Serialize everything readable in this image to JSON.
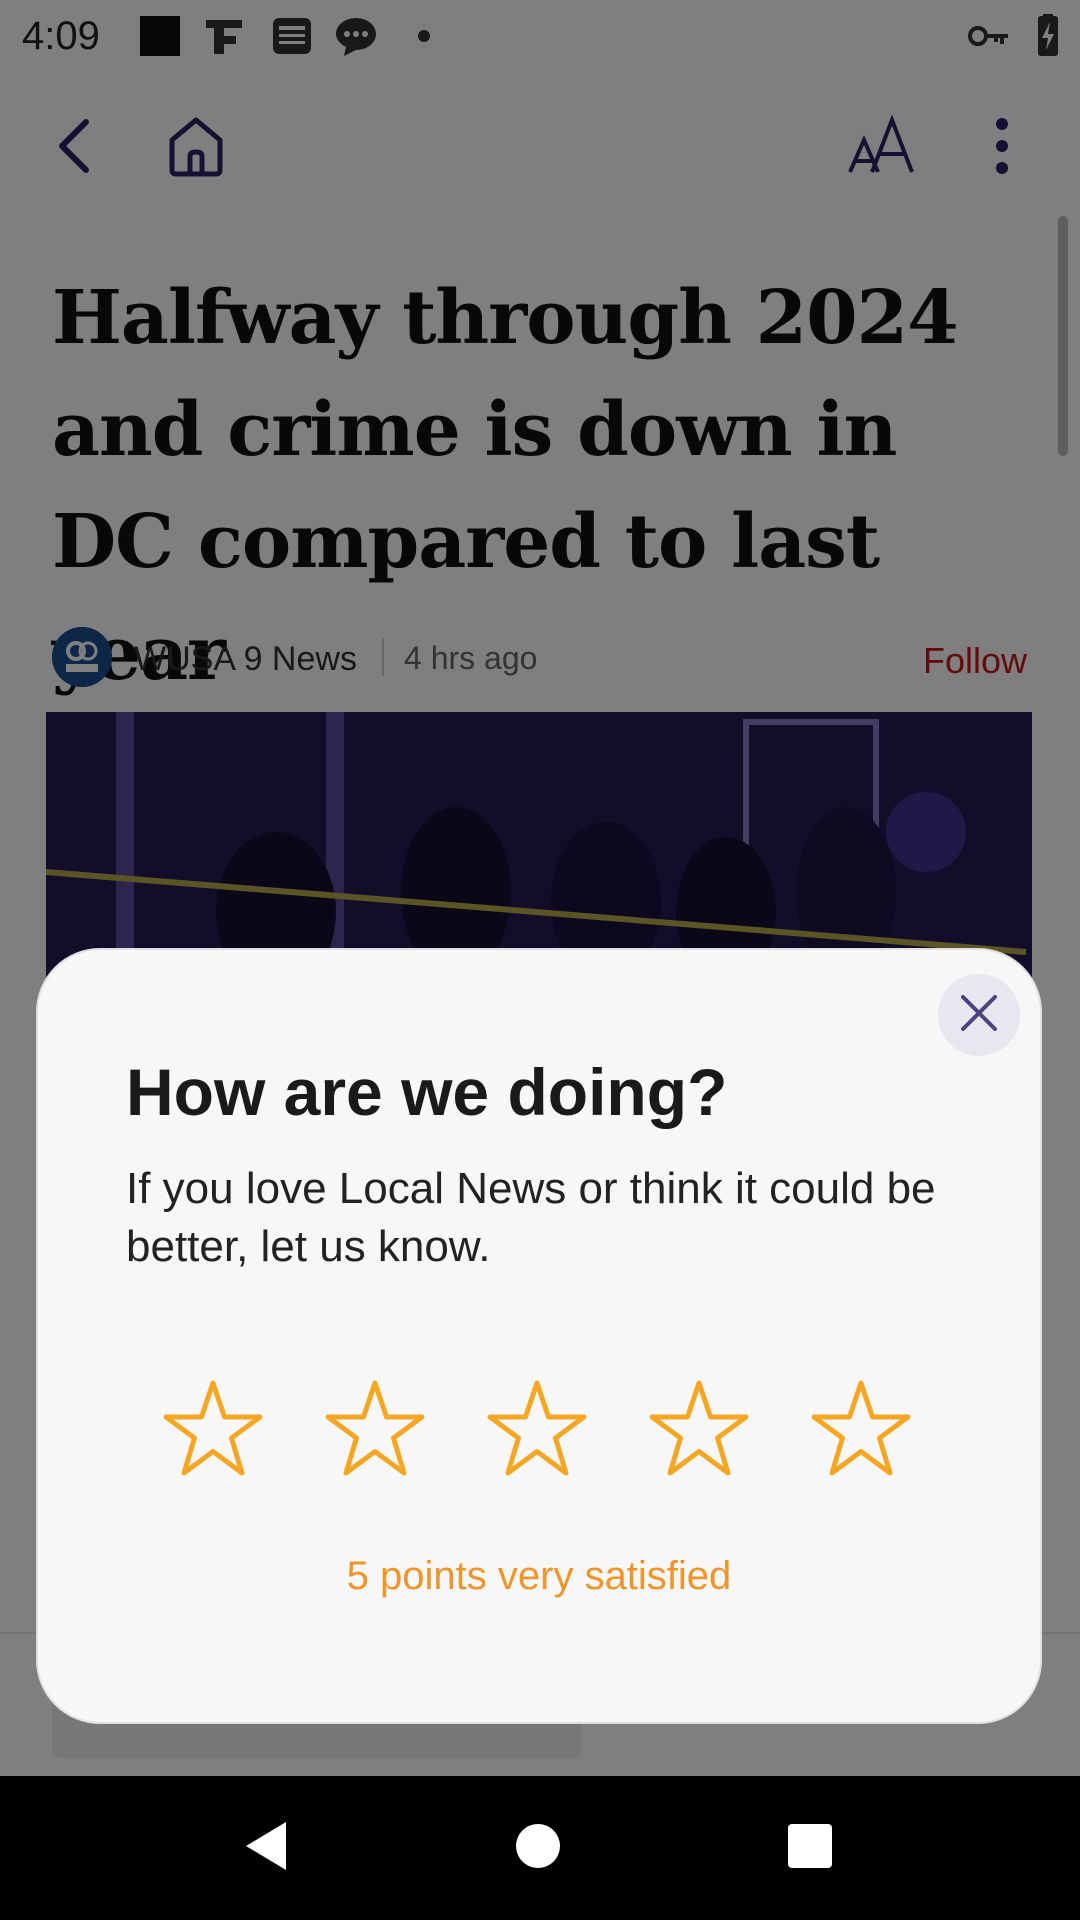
{
  "status_bar": {
    "time": "4:09",
    "icons": [
      "stop-square-icon",
      "flipboard-icon",
      "news-app-icon",
      "chat-bubble-icon",
      "dot-icon",
      "vpn-key-icon",
      "battery-charging-icon"
    ]
  },
  "app_bar": {
    "icons": [
      "back-arrow-icon",
      "home-icon",
      "text-size-icon",
      "more-vert-icon"
    ],
    "text_size_label": "AA"
  },
  "article": {
    "headline": "Halfway through 2024 and crime is down in DC compared to last year",
    "source_name": "WUSA 9 News",
    "time_ago": "4 hrs ago",
    "follow_label": "Follow",
    "logo_text": "9 WUSA"
  },
  "dialog": {
    "title": "How are we doing?",
    "message": "If you love Local News or think it could be better, let us know.",
    "star_count": 5,
    "rating_caption": "5 points very satisfied",
    "star_color": "#f5a623",
    "caption_color": "#f0952a"
  },
  "nav_bar": {
    "icons": [
      "nav-back-icon",
      "nav-home-icon",
      "nav-recents-icon"
    ]
  },
  "colors": {
    "accent": "#2b2366",
    "follow": "#c4151c",
    "scrim": "rgba(0,0,0,0.5)"
  }
}
